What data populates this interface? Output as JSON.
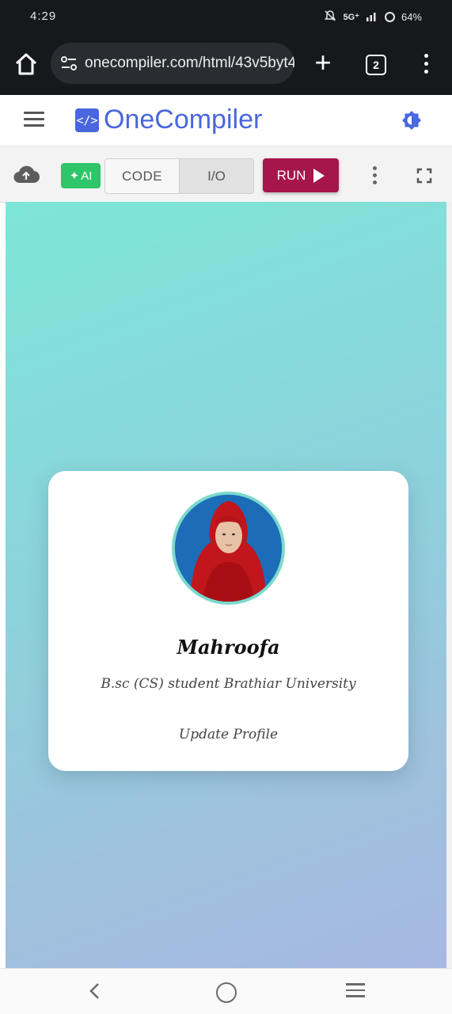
{
  "status": {
    "time": "4:29",
    "network": "5G⁺",
    "battery": "64%"
  },
  "browser": {
    "url": "onecompiler.com/html/43v5byt4",
    "tab_count": "2"
  },
  "site": {
    "logo_symbol": "</>",
    "logo_text": "OneCompiler"
  },
  "editor": {
    "ai_label": "AI",
    "code_tab": "CODE",
    "io_tab": "I/O",
    "run_label": "RUN"
  },
  "profile": {
    "name": "Mahroofa",
    "subtitle": "B.sc (CS) student Brathiar University",
    "link": "Update Profile"
  },
  "colors": {
    "brand": "#4a66de",
    "run": "#a5164b",
    "ai": "#2fc56a",
    "gradient_start": "#7de6d8",
    "gradient_end": "#a7b8e2"
  },
  "icons": {
    "home": "home-icon",
    "tune": "site-settings-icon",
    "new_tab": "plus-icon",
    "tabs": "tab-switcher-icon",
    "menu": "more-vert-icon",
    "theme": "brightness-icon",
    "cloud": "cloud-upload-icon",
    "fullscreen": "fullscreen-icon"
  }
}
